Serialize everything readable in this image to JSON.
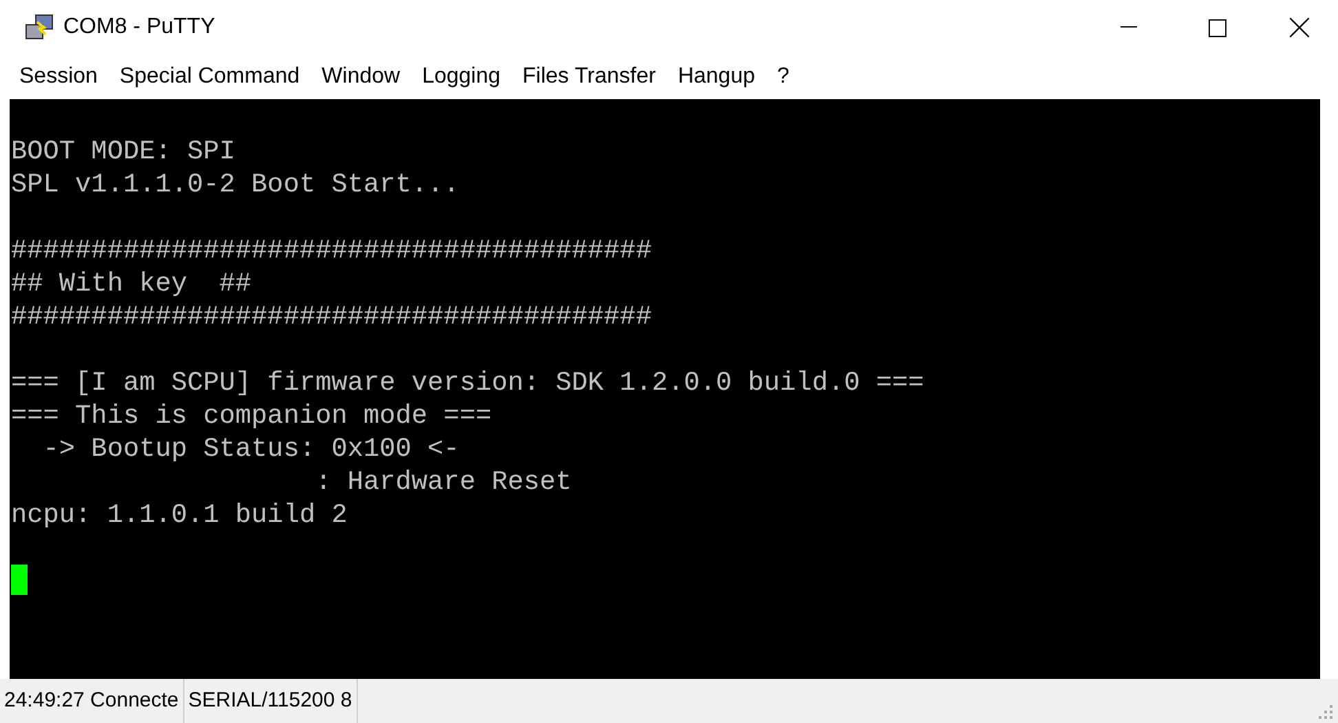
{
  "window": {
    "title": "COM8 - PuTTY"
  },
  "menu": [
    "Session",
    "Special Command",
    "Window",
    "Logging",
    "Files Transfer",
    "Hangup",
    "?"
  ],
  "terminal": {
    "blocks": [
      {
        "lines": [
          "BOOT MODE: SPI",
          "SPL v1.1.1.0-2 Boot Start..."
        ]
      },
      {
        "lines": [
          "########################################",
          "## With key  ##",
          "########################################"
        ]
      },
      {
        "lines": [
          "=== [I am SCPU] firmware version: SDK 1.2.0.0 build.0 ===",
          "=== This is companion mode ===",
          "  -> Bootup Status: 0x100 <-",
          "                   : Hardware Reset",
          "ncpu: 1.1.0.1 build 2"
        ]
      }
    ]
  },
  "status_bar": [
    "24:49:27 Connecte",
    "SERIAL/115200 8"
  ]
}
